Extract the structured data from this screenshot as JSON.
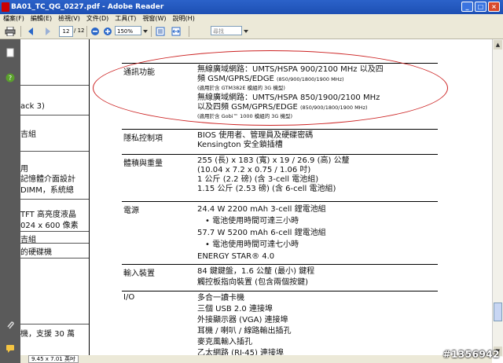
{
  "window": {
    "title": "BA01_TC_QG_0227.pdf - Adobe Reader",
    "min": "_",
    "max": "□",
    "close": "×"
  },
  "menu": [
    "檔案(F)",
    "編輯(E)",
    "檢視(V)",
    "文件(D)",
    "工具(T)",
    "視窗(W)",
    "說明(H)"
  ],
  "toolbar": {
    "page_current": "12",
    "page_total": "/ 12",
    "zoom": "150%",
    "search_placeholder": "尋找"
  },
  "status": {
    "page_size": "9.45 x 7.01 英吋"
  },
  "left_fragments": [
    "ack 3)",
    "吉組",
    "用",
    "記憶體介面設計",
    "DIMM，系統總",
    "TFT 高亮度液晶",
    "024 x 600 像素",
    "吉組",
    "的硬碟機",
    "機，支援 30 萬"
  ],
  "spec": {
    "rows": [
      {
        "label": "通訊功能",
        "lines": [
          {
            "main": "無線廣域網路：UMTS/HSPA 900/2100 MHz 以及四",
            "small": ""
          },
          {
            "main": "頻 GSM/GPRS/EDGE",
            "small": "(850/900/1800/1900 MHz)"
          },
          {
            "main": "",
            "small": "(適用於含 GTM382E 模組的 3G 機型)"
          },
          {
            "main": "無線廣域網路：UMTS/HSPA 850/1900/2100 MHz",
            "small": ""
          },
          {
            "main": "以及四頻 GSM/GPRS/EDGE",
            "small": "(850/900/1800/1900 MHz)"
          },
          {
            "main": "",
            "small": "(適用於含 Gobi™ 1000 模組的 3G 機型)"
          }
        ]
      },
      {
        "label": "隱私控制項",
        "lines": [
          {
            "main": "BIOS 使用者、管理員及硬碟密碼",
            "small": ""
          },
          {
            "main": "Kensington 安全鎖插槽",
            "small": ""
          }
        ]
      },
      {
        "label": "體積與重量",
        "lines": [
          {
            "main": "255 (長) x 183 (寬) x 19 / 26.9 (高) 公釐",
            "small": ""
          },
          {
            "main": "(10.04 x 7.2 x 0.75 / 1.06 吋)",
            "small": ""
          },
          {
            "main": "1 公斤 (2.2 磅) (含 3-cell 電池組)",
            "small": ""
          },
          {
            "main": "1.15 公斤 (2.53 磅) (含 6-cell 電池組)",
            "small": ""
          }
        ]
      },
      {
        "label": "電源",
        "lines": [
          {
            "main": "24.4 W 2200 mAh 3-cell 鋰電池組",
            "small": ""
          },
          {
            "main": "• 電池使用時間可達三小時",
            "small": "",
            "bullet": true
          },
          {
            "main": "57.7 W 5200 mAh 6-cell 鋰電池組",
            "small": ""
          },
          {
            "main": "• 電池使用時間可達七小時",
            "small": "",
            "bullet": true
          },
          {
            "main": "ENERGY STAR® 4.0",
            "small": ""
          }
        ]
      },
      {
        "label": "輸入裝置",
        "lines": [
          {
            "main": "84 鍵鍵盤，1.6 公釐 (最小) 鍵程",
            "small": ""
          },
          {
            "main": "觸控板指向裝置 (包含兩個按鍵)",
            "small": ""
          }
        ]
      },
      {
        "label": "I/O",
        "lines": [
          {
            "main": "多合一讀卡機",
            "small": ""
          },
          {
            "main": "三個 USB 2.0 連接埠",
            "small": ""
          },
          {
            "main": "外接顯示器 (VGA) 連接埠",
            "small": ""
          },
          {
            "main": "耳機 / 喇叭 / 線路輸出插孔",
            "small": ""
          },
          {
            "main": "麥克風輸入插孔",
            "small": ""
          },
          {
            "main": "乙太網路 (RJ-45) 連接埠",
            "small": ""
          }
        ]
      }
    ]
  },
  "watermark": "#1356942",
  "colors": {
    "titlebar": "#1d4fb3",
    "annotation": "#cc2222",
    "rail": "#5a5a5a"
  }
}
